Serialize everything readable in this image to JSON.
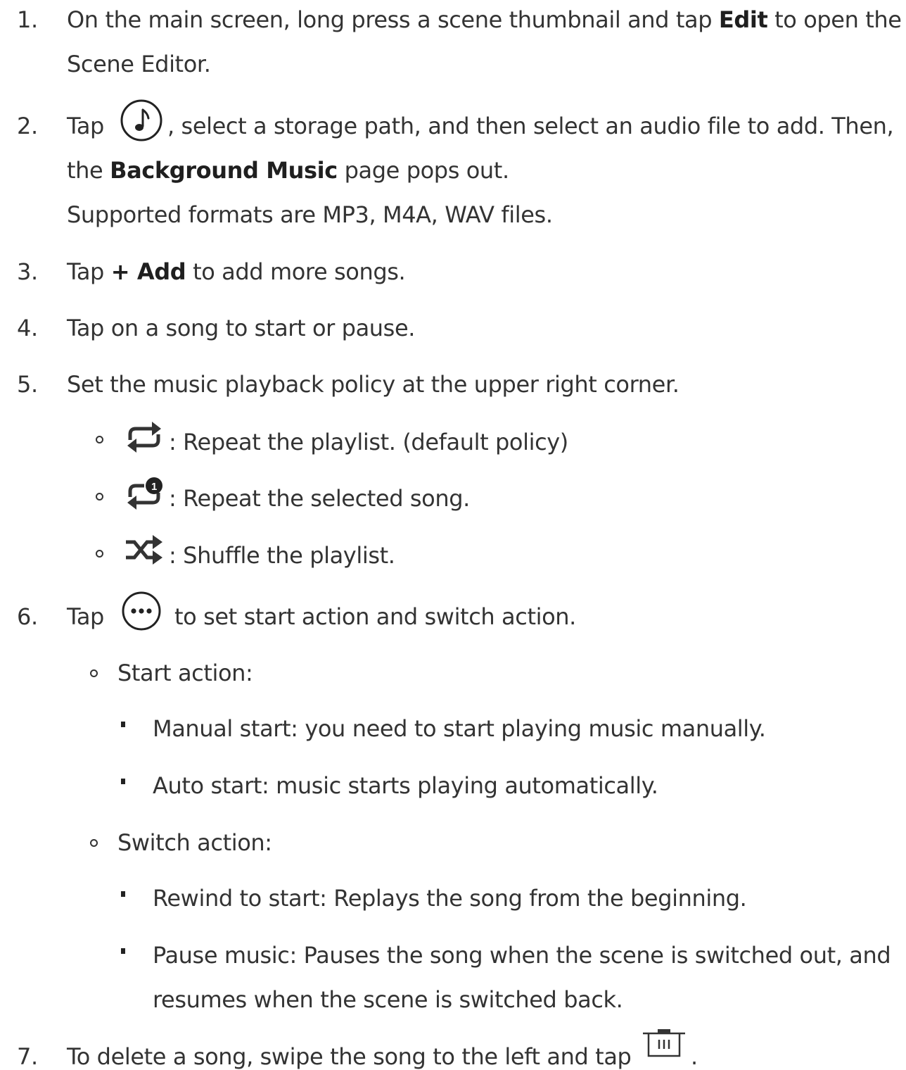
{
  "steps": [
    {
      "num": "1.",
      "l1_a": "On the main screen, long press a scene thumbnail and tap ",
      "l1_b": "Edit",
      "l1_c": " to open the",
      "l2": "Scene Editor."
    },
    {
      "num": "2.",
      "l1_a": "Tap ",
      "l1_c": ", select a storage path, and then select an audio file to add. Then,",
      "l2_a": "the ",
      "l2_b": "Background Music",
      "l2_c": " page pops out.",
      "l3": "Supported formats are MP3, M4A, WAV files.",
      "icon": "music-note-icon"
    },
    {
      "num": "3.",
      "a": "Tap ",
      "b": "+ Add",
      "c": " to add more songs."
    },
    {
      "num": "4.",
      "a": "Tap on a song to start or pause."
    },
    {
      "num": "5.",
      "a": "Set the music playback policy at the upper right corner.",
      "policies": [
        {
          "icon": "repeat-icon",
          "text": ": Repeat the playlist. (default policy)"
        },
        {
          "icon": "repeat-one-icon",
          "text": ": Repeat the selected song."
        },
        {
          "icon": "shuffle-icon",
          "text": ": Shuffle the playlist."
        }
      ]
    },
    {
      "num": "6.",
      "a": "Tap ",
      "c": "to set start action and switch action.",
      "icon": "more-icon",
      "groups": [
        {
          "title": "Start action:",
          "items": [
            "Manual start: you need to start playing music manually.",
            "Auto start: music starts playing automatically."
          ]
        },
        {
          "title": "Switch action:",
          "items": [
            "Rewind to start: Replays the song from the beginning.",
            "Pause music: Pauses the song when the scene is switched out, and",
            "resumes when the scene is switched back."
          ]
        }
      ]
    },
    {
      "num": "7.",
      "a": "To delete a song, swipe the song to the left and tap ",
      "c": ".",
      "icon": "trash-icon"
    }
  ]
}
